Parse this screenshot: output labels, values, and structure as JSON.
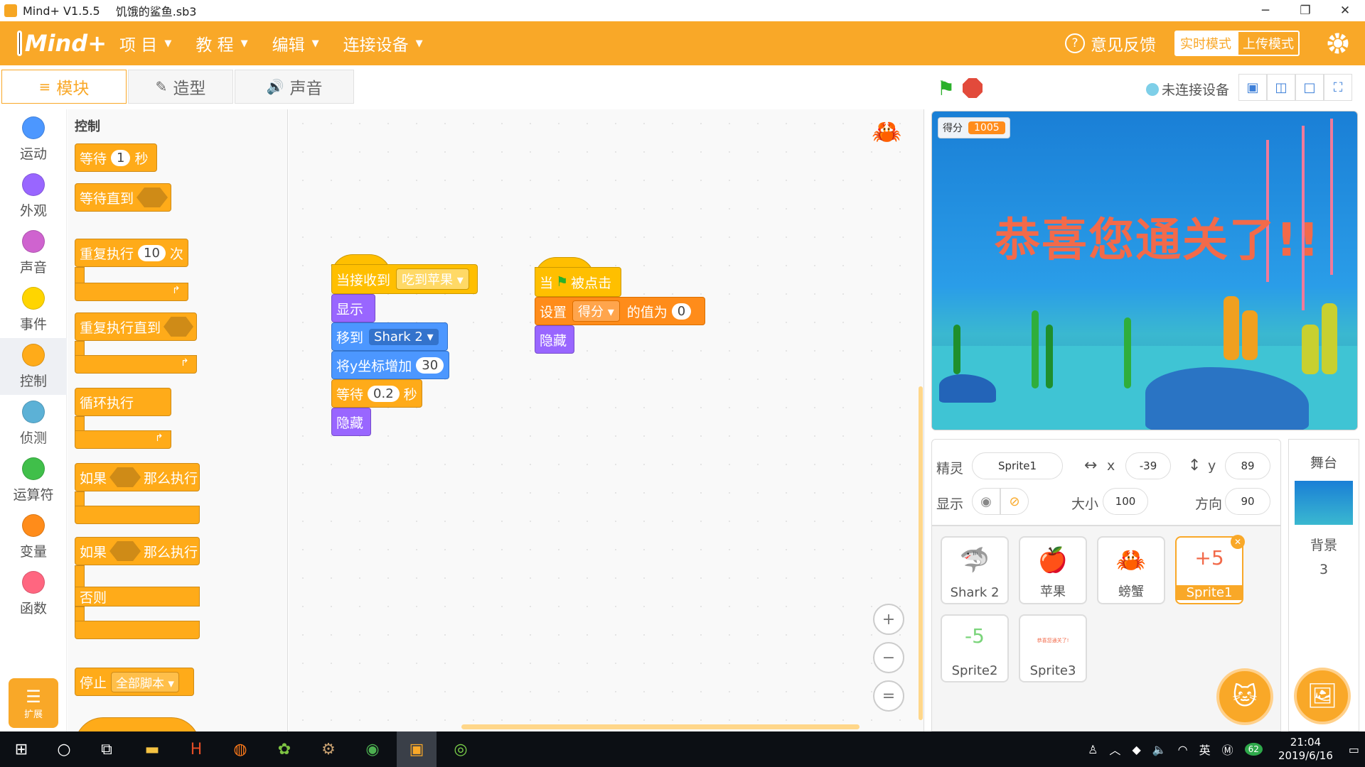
{
  "window": {
    "app_title": "Mind+ V1.5.5",
    "file_name": "饥饿的鲨鱼.sb3",
    "minimize": "─",
    "restore": "❐",
    "close": "✕"
  },
  "menubar": {
    "logo": "Mind+",
    "items": [
      {
        "label": "项 目"
      },
      {
        "label": "教 程"
      },
      {
        "label": "编辑"
      },
      {
        "label": "连接设备"
      }
    ],
    "feedback": "意见反馈",
    "mode_realtime": "实时模式",
    "mode_upload": "上传模式"
  },
  "tabs": [
    {
      "label": "模块",
      "icon": "≡"
    },
    {
      "label": "造型",
      "icon": "✎"
    },
    {
      "label": "声音",
      "icon": "🔊"
    }
  ],
  "categories": [
    {
      "label": "运动",
      "color": "#4c97ff"
    },
    {
      "label": "外观",
      "color": "#9966ff"
    },
    {
      "label": "声音",
      "color": "#cf63cf"
    },
    {
      "label": "事件",
      "color": "#ffd500"
    },
    {
      "label": "控制",
      "color": "#ffab19"
    },
    {
      "label": "侦测",
      "color": "#5cb1d6"
    },
    {
      "label": "运算符",
      "color": "#40bf4a"
    },
    {
      "label": "变量",
      "color": "#ff8c1a"
    },
    {
      "label": "函数",
      "color": "#ff6680"
    }
  ],
  "extension_label": "扩展",
  "palette": {
    "title": "控制",
    "wait": {
      "prefix": "等待",
      "value": "1",
      "suffix": "秒"
    },
    "wait_until": "等待直到",
    "repeat": {
      "prefix": "重复执行",
      "value": "10",
      "suffix": "次"
    },
    "repeat_until": "重复执行直到",
    "forever": "循环执行",
    "if_then": {
      "prefix": "如果",
      "suffix": "那么执行"
    },
    "if_else": {
      "prefix": "如果",
      "suffix": "那么执行",
      "else": "否则"
    },
    "stop": {
      "prefix": "停止",
      "option": "全部脚本"
    }
  },
  "script1": {
    "hat_prefix": "当接收到",
    "hat_message": "吃到苹果",
    "show": "显示",
    "goto_prefix": "移到",
    "goto_target": "Shark 2",
    "change_y_prefix": "将y坐标增加",
    "change_y_value": "30",
    "wait_prefix": "等待",
    "wait_value": "0.2",
    "wait_suffix": "秒",
    "hide": "隐藏"
  },
  "script2": {
    "hat_prefix": "当",
    "hat_suffix": "被点击",
    "set_prefix": "设置",
    "set_var": "得分",
    "set_mid": "的值为",
    "set_value": "0",
    "hide": "隐藏"
  },
  "zoom": {
    "in": "+",
    "out": "−",
    "reset": "="
  },
  "stage_header": {
    "connection": "未连接设备"
  },
  "stage": {
    "score_label": "得分",
    "score_value": "1005",
    "congrats_text": "恭喜您通关了!!"
  },
  "sprite_info": {
    "sprite_label": "精灵",
    "sprite_name": "Sprite1",
    "x_label": "x",
    "x_value": "-39",
    "y_label": "y",
    "y_value": "89",
    "show_label": "显示",
    "size_label": "大小",
    "size_value": "100",
    "direction_label": "方向",
    "direction_value": "90"
  },
  "sprites": [
    {
      "name": "Shark 2",
      "icon": "🦈"
    },
    {
      "name": "苹果",
      "icon": "🍎"
    },
    {
      "name": "螃蟹",
      "icon": "🦀"
    },
    {
      "name": "Sprite1",
      "icon": "+5"
    },
    {
      "name": "Sprite2",
      "icon": "-5"
    },
    {
      "name": "Sprite3",
      "icon": "恭喜您通关了!"
    }
  ],
  "stage_panel": {
    "title": "舞台",
    "backdrop_label": "背景",
    "backdrop_count": "3"
  },
  "taskbar": {
    "input_mode": "英",
    "battery": "62",
    "time": "21:04",
    "date": "2019/6/16"
  }
}
